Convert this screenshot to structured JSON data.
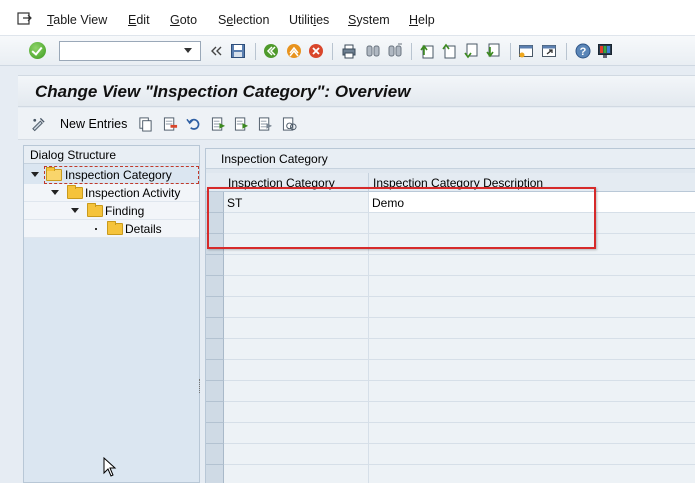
{
  "menu": {
    "items": [
      "Table View",
      "Edit",
      "Goto",
      "Selection",
      "Utilities",
      "System",
      "Help"
    ]
  },
  "toolbar": {
    "command_value": "",
    "icons": [
      "enter-icon",
      "back-arrow-icon",
      "save-icon",
      "back-icon",
      "exit-icon",
      "cancel-icon",
      "print-icon",
      "find-icon",
      "find-next-icon",
      "first-page-icon",
      "previous-page-icon",
      "next-page-icon",
      "last-page-icon",
      "create-session-icon",
      "shortcut-icon",
      "help-icon",
      "customize-layout-icon"
    ]
  },
  "title": "Change View \"Inspection Category\": Overview",
  "app_toolbar": {
    "new_entries": "New Entries"
  },
  "dialog_structure": {
    "heading": "Dialog Structure",
    "nodes": [
      {
        "label": "Inspection Category"
      },
      {
        "label": "Inspection Activity"
      },
      {
        "label": "Finding"
      },
      {
        "label": "Details"
      }
    ]
  },
  "table": {
    "title": "Inspection Category",
    "columns": [
      "Inspection Category",
      "Inspection Category Description"
    ],
    "rows": [
      {
        "category": "ST",
        "description": "Demo"
      }
    ]
  },
  "colors": {
    "highlight": "#d62a2a",
    "panel_bg": "#dbe6f1"
  }
}
